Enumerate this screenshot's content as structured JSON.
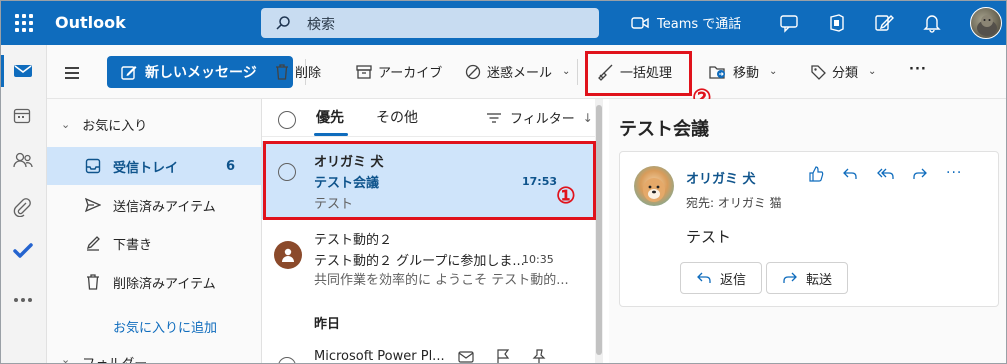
{
  "topbar": {
    "brand": "Outlook",
    "search_placeholder": "検索",
    "teams_label": "Teams で通話",
    "icons": [
      "app-launcher-icon",
      "search-icon",
      "video-icon",
      "chat-icon",
      "office-icon",
      "feedback-icon",
      "bell-icon"
    ]
  },
  "toolbar": {
    "new_message": "新しいメッセージ",
    "delete": "削除",
    "archive": "アーカイブ",
    "junk": "迷惑メール",
    "sweep": "一括処理",
    "move": "移動",
    "categorize": "分類",
    "more": "···",
    "annotation_1": "①",
    "annotation_2": "②"
  },
  "folders": {
    "favorites_label": "お気に入り",
    "items": [
      {
        "label": "受信トレイ",
        "count": "6"
      },
      {
        "label": "送信済みアイテム"
      },
      {
        "label": "下書き"
      },
      {
        "label": "削除済みアイテム"
      }
    ],
    "add_favorite": "お気に入りに追加",
    "folders_label": "フォルダー"
  },
  "list": {
    "tab_focused": "優先",
    "tab_other": "その他",
    "filter": "フィルター",
    "messages": [
      {
        "from": "オリガミ 犬",
        "subject": "テスト会議",
        "time": "17:53",
        "preview": "テスト"
      },
      {
        "from": "テスト動的２",
        "subject": "テスト動的２ グループに参加しま...",
        "time": "10:35",
        "preview": "共同作業を効率的に ようこそ テスト動的..."
      },
      {
        "from": "Microsoft Power Pl..."
      }
    ],
    "group_yesterday": "昨日"
  },
  "reading": {
    "title": "テスト会議",
    "sender": "オリガミ 犬",
    "to": "宛先: オリガミ 猫",
    "body": "テスト",
    "reply": "返信",
    "forward": "転送"
  },
  "colors": {
    "brand": "#0f6cbd",
    "selected": "#cfe4fa",
    "highlight": "#e0121b"
  }
}
